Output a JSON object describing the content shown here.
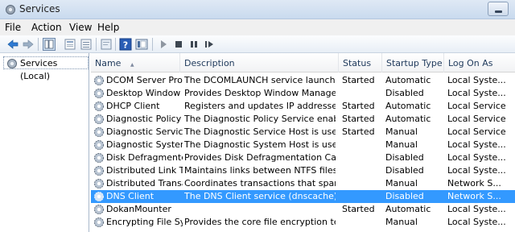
{
  "window": {
    "title": "Services"
  },
  "menu": {
    "file": "File",
    "action": "Action",
    "view": "View",
    "help": "Help"
  },
  "toolbar": {
    "buttons": [
      "back-arrow-icon",
      "forward-arrow-icon",
      "show-hide-tree-icon",
      "properties-icon",
      "export-list-icon",
      "help-icon",
      "console-view-icon",
      "start-service-icon",
      "stop-service-icon",
      "pause-service-icon",
      "restart-service-icon"
    ]
  },
  "sidebar": {
    "item": "Services (Local)"
  },
  "table": {
    "columns": {
      "name": "Name",
      "description": "Description",
      "status": "Status",
      "startup_type": "Startup Type",
      "log_on_as": "Log On As"
    },
    "sorted_column": "Name",
    "rows": [
      {
        "name": "DCOM Server Pro...",
        "description": "The DCOMLAUNCH service launches C...",
        "status": "Started",
        "startup": "Automatic",
        "logon": "Local Syste..."
      },
      {
        "name": "Desktop Window ...",
        "description": "Provides Desktop Window Manager sta...",
        "status": "",
        "startup": "Disabled",
        "logon": "Local Syste..."
      },
      {
        "name": "DHCP Client",
        "description": "Registers and updates IP addresses and ...",
        "status": "Started",
        "startup": "Automatic",
        "logon": "Local Service"
      },
      {
        "name": "Diagnostic Policy ...",
        "description": "The Diagnostic Policy Service enables p...",
        "status": "Started",
        "startup": "Automatic",
        "logon": "Local Service"
      },
      {
        "name": "Diagnostic Service...",
        "description": "The Diagnostic Service Host is used by t...",
        "status": "Started",
        "startup": "Manual",
        "logon": "Local Service"
      },
      {
        "name": "Diagnostic System...",
        "description": "The Diagnostic System Host is used by ...",
        "status": "",
        "startup": "Manual",
        "logon": "Local Syste..."
      },
      {
        "name": "Disk Defragmenter",
        "description": "Provides Disk Defragmentation Capabili...",
        "status": "",
        "startup": "Disabled",
        "logon": "Local Syste..."
      },
      {
        "name": "Distributed Link Tr...",
        "description": "Maintains links between NTFS files with...",
        "status": "",
        "startup": "Disabled",
        "logon": "Local Syste..."
      },
      {
        "name": "Distributed Transa...",
        "description": "Coordinates transactions that span mul...",
        "status": "",
        "startup": "Manual",
        "logon": "Network S..."
      },
      {
        "name": "DNS Client",
        "description": "The DNS Client service (dnscache) cach...",
        "status": "",
        "startup": "Disabled",
        "logon": "Network S...",
        "selected": true
      },
      {
        "name": "DokanMounter",
        "description": "",
        "status": "Started",
        "startup": "Automatic",
        "logon": "Local Syste..."
      },
      {
        "name": "Encrypting File Sy...",
        "description": "Provides the core file encryption techn...",
        "status": "",
        "startup": "Manual",
        "logon": "Local Syste..."
      }
    ]
  },
  "colors": {
    "selection": "#3399ff",
    "title_bar": "#dfe9f5",
    "header_text": "#1e395b"
  }
}
